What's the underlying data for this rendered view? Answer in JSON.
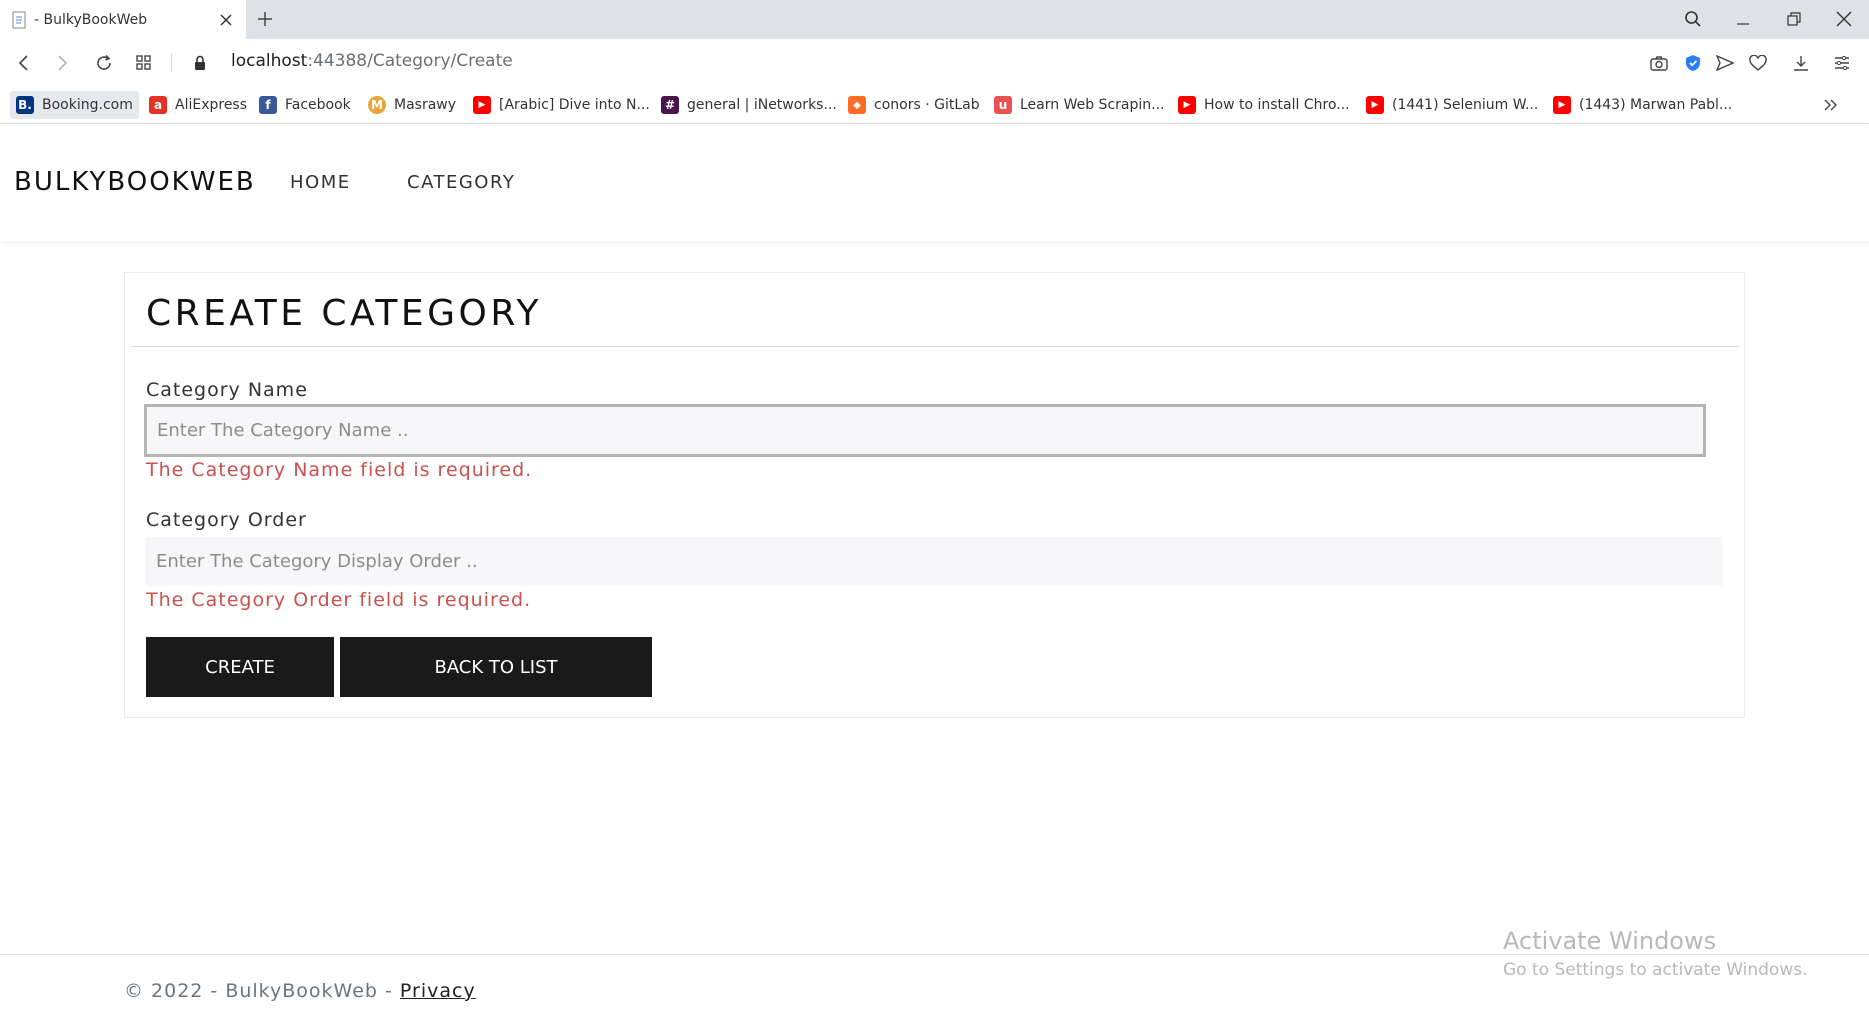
{
  "browser": {
    "tab_title": "- BulkyBookWeb",
    "url_host": "localhost",
    "url_rest": ":44388/Category/Create",
    "bookmarks": [
      {
        "label": "Booking.com",
        "icon": "booking-icon",
        "color": "#003580",
        "glyph": "B."
      },
      {
        "label": "AliExpress",
        "icon": "aliexpress-icon",
        "color": "#e43225",
        "glyph": "a"
      },
      {
        "label": "Facebook",
        "icon": "facebook-icon",
        "color": "#3b5998",
        "glyph": "f"
      },
      {
        "label": "Masrawy",
        "icon": "masrawy-icon",
        "color": "#e8a33a",
        "glyph": "M"
      },
      {
        "label": "[Arabic] Dive into N...",
        "icon": "youtube-icon",
        "color": "#ff0000",
        "glyph": "▶"
      },
      {
        "label": "general | iNetworks...",
        "icon": "slack-icon",
        "color": "#4a154b",
        "glyph": "#"
      },
      {
        "label": "conors · GitLab",
        "icon": "gitlab-icon",
        "color": "#fc6d26",
        "glyph": "◆"
      },
      {
        "label": "Learn Web Scrapin...",
        "icon": "udemy-icon",
        "color": "#ea5252",
        "glyph": "u"
      },
      {
        "label": "How to install Chro...",
        "icon": "youtube-icon",
        "color": "#ff0000",
        "glyph": "▶"
      },
      {
        "label": "(1441) Selenium W...",
        "icon": "youtube-icon",
        "color": "#ff0000",
        "glyph": "▶"
      },
      {
        "label": "(1443) Marwan Pabl...",
        "icon": "youtube-icon",
        "color": "#ff0000",
        "glyph": "▶"
      }
    ]
  },
  "navbar": {
    "brand": "BULKYBOOKWEB",
    "links": [
      "HOME",
      "CATEGORY"
    ]
  },
  "form": {
    "title": "CREATE CATEGORY",
    "name_label": "Category Name",
    "name_placeholder": "Enter The Category Name ..",
    "name_error": "The Category Name field is required.",
    "order_label": "Category Order",
    "order_placeholder": "Enter The Category Display Order ..",
    "order_error": "The Category Order field is required.",
    "create_label": "CREATE",
    "back_label": "BACK TO LIST"
  },
  "footer": {
    "text": "© 2022 - BulkyBookWeb - ",
    "privacy": "Privacy"
  },
  "watermark": {
    "line1": "Activate Windows",
    "line2": "Go to Settings to activate Windows."
  }
}
